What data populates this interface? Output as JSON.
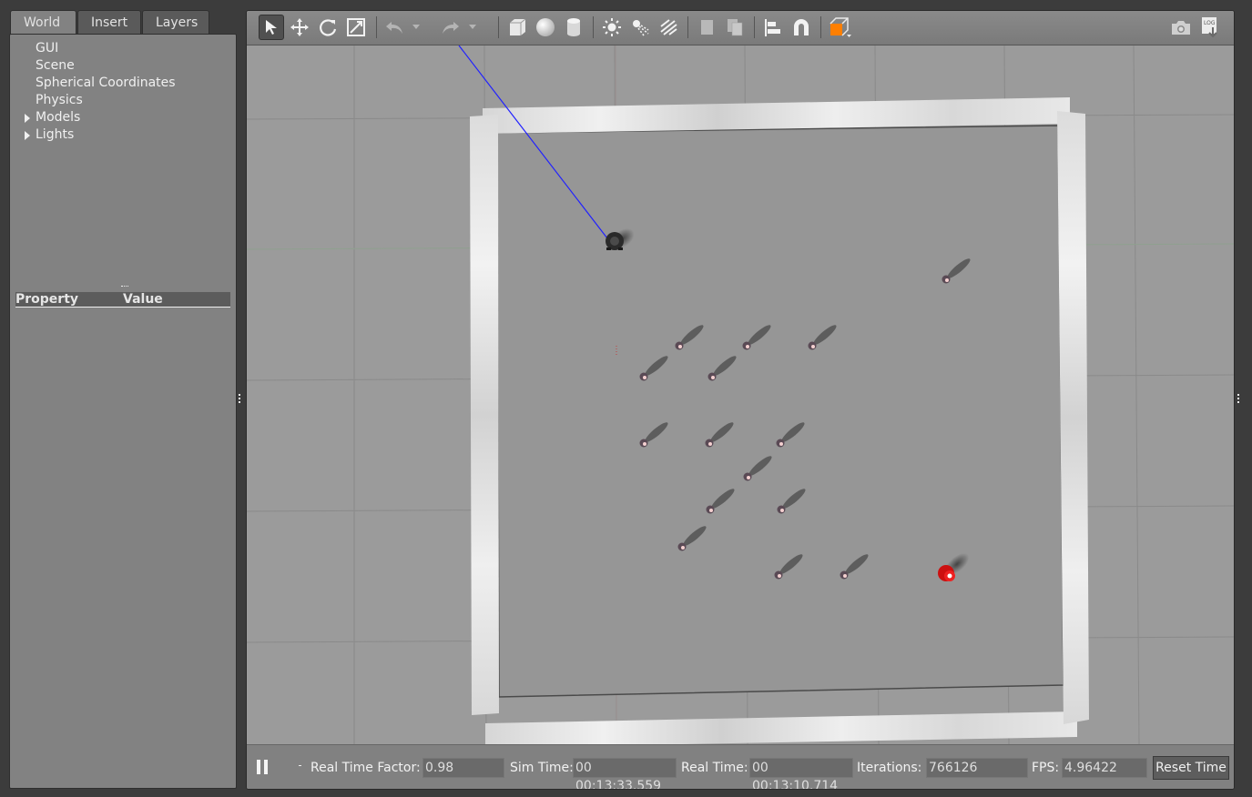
{
  "left_panel": {
    "tabs": [
      {
        "label": "World"
      },
      {
        "label": "Insert"
      },
      {
        "label": "Layers"
      }
    ],
    "tree": [
      {
        "label": "GUI",
        "expandable": false
      },
      {
        "label": "Scene",
        "expandable": false
      },
      {
        "label": "Spherical Coordinates",
        "expandable": false
      },
      {
        "label": "Physics",
        "expandable": false
      },
      {
        "label": "Models",
        "expandable": true
      },
      {
        "label": "Lights",
        "expandable": true
      }
    ],
    "property_header": {
      "property": "Property",
      "value": "Value"
    }
  },
  "toolbar": {
    "icons": [
      "select-arrow-icon",
      "translate-icon",
      "rotate-icon",
      "scale-icon",
      "undo-icon",
      "undo-dropdown-icon",
      "redo-icon",
      "redo-dropdown-icon",
      "box-icon",
      "sphere-icon",
      "cylinder-icon",
      "point-light-icon",
      "spot-light-icon",
      "directional-light-icon",
      "copy-icon",
      "paste-icon",
      "align-icon",
      "snap-magnet-icon",
      "view-angle-icon",
      "screenshot-icon",
      "log-icon"
    ],
    "accent": "#ff7f00"
  },
  "scene": {
    "ground_color": "#9b9b9b",
    "wall_color": "#dcdcdc",
    "robot_color": "#2a2a2a",
    "obstacle_color": "#5a4a55",
    "target_color": "#d81010",
    "ray_color": "#1a1aff"
  },
  "status": {
    "real_time_factor_label": "Real Time Factor:",
    "real_time_factor": "0.98",
    "sim_time_label": "Sim Time:",
    "sim_time": "00 00:13:33.559",
    "real_time_label": "Real Time:",
    "real_time": "00 00:13:10.714",
    "iterations_label": "Iterations:",
    "iterations": "766126",
    "fps_label": "FPS:",
    "fps": "4.96422",
    "reset_button": "Reset Time"
  }
}
